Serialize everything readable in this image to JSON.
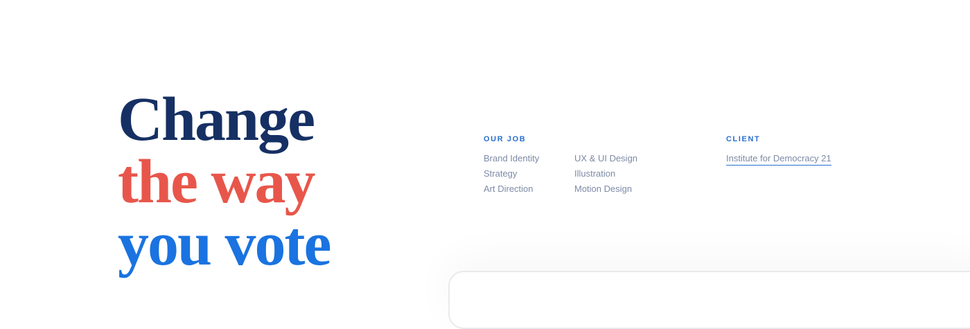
{
  "headline": {
    "line1": "Change",
    "line2": "the way",
    "line3": "you vote"
  },
  "our_job": {
    "label": "OUR JOB",
    "column1": [
      "Brand Identity",
      "Strategy",
      "Art Direction"
    ],
    "column2": [
      "UX & UI Design",
      "Illustration",
      "Motion Design"
    ]
  },
  "client": {
    "label": "CLIENT",
    "name": "Institute for Democracy 21"
  },
  "colors": {
    "navy": "#163064",
    "coral": "#e8564b",
    "blue": "#1a73e0",
    "label_blue": "#2a6fcf",
    "muted_text": "#7d8aa6"
  }
}
